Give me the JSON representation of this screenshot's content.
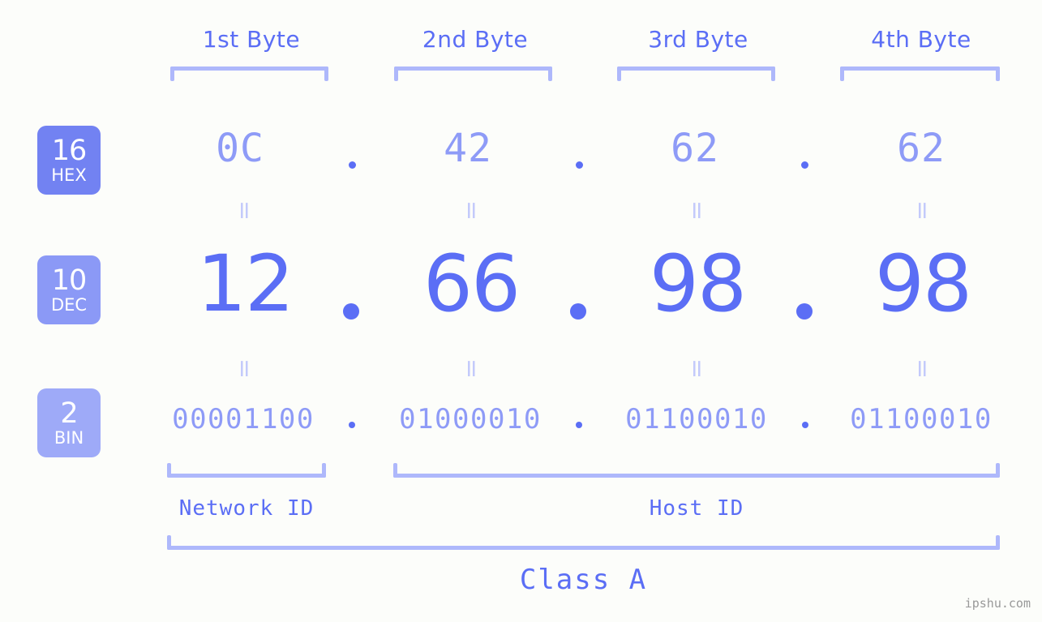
{
  "meta": {
    "watermark": "ipshu.com",
    "background": "#fcfdfa",
    "accent": "#5b6ef5",
    "accent_light": "#8e9bf7",
    "bracket_color": "#aeb8fb",
    "eq_color": "#c3cafb"
  },
  "byte_headers": [
    {
      "label": "1st Byte"
    },
    {
      "label": "2nd Byte"
    },
    {
      "label": "3rd Byte"
    },
    {
      "label": "4th Byte"
    }
  ],
  "radix_badges": [
    {
      "number": "16",
      "label": "HEX",
      "color": "#7282f2"
    },
    {
      "number": "10",
      "label": "DEC",
      "color": "#8b99f6"
    },
    {
      "number": "2",
      "label": "BIN",
      "color": "#9eaaf8"
    }
  ],
  "rows": {
    "hex": {
      "radix": "16",
      "name": "HEX",
      "values": [
        "0C",
        "42",
        "62",
        "62"
      ]
    },
    "dec": {
      "radix": "10",
      "name": "DEC",
      "values": [
        "12",
        "66",
        "98",
        "98"
      ]
    },
    "bin": {
      "radix": "2",
      "name": "BIN",
      "values": [
        "00001100",
        "01000010",
        "01100010",
        "01100010"
      ]
    }
  },
  "separators": {
    "hex": ".",
    "dec": ".",
    "bin": "."
  },
  "equals_marks": {
    "symbol": "=",
    "count_per_gap": 4
  },
  "id_sections": [
    {
      "label": "Network ID",
      "span_bytes": 1
    },
    {
      "label": "Host ID",
      "span_bytes": 3
    }
  ],
  "class_section": {
    "label": "Class A"
  },
  "address": {
    "hex": "0C.42.62.62",
    "dec": "12.66.98.98",
    "bin": "00001100.01000010.01100010.01100010"
  }
}
